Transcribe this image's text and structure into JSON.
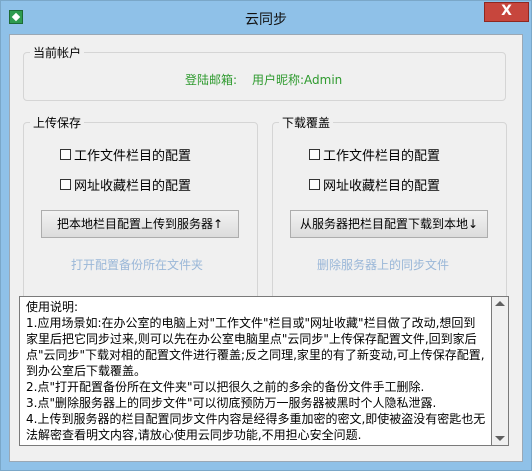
{
  "window": {
    "title": "云同步",
    "close_glyph": "X"
  },
  "account": {
    "group_title": "当前帐户",
    "email_label": "登陆邮箱:",
    "nickname_text": "用户昵称:Admin"
  },
  "upload": {
    "group_title": "上传保存",
    "checkbox_1": "工作文件栏目的配置",
    "checkbox_2": "网址收藏栏目的配置",
    "button": "把本地栏目配置上传到服务器↑",
    "link": "打开配置备份所在文件夹"
  },
  "download": {
    "group_title": "下载覆盖",
    "checkbox_1": "工作文件栏目的配置",
    "checkbox_2": "网址收藏栏目的配置",
    "button": "从服务器把栏目配置下载到本地↓",
    "link": "删除服务器上的同步文件"
  },
  "instructions": {
    "heading": "使用说明:",
    "item_1": "1.应用场景如:在办公室的电脑上对\"工作文件\"栏目或\"网址收藏\"栏目做了改动,想回到家里后把它同步过来,则可以先在办公室电脑里点\"云同步\"上传保存配置文件,回到家后点\"云同步\"下载对相的配置文件进行覆盖;反之同理,家里的有了新变动,可上传保存配置,到办公室后下载覆盖。",
    "item_2": "2.点\"打开配置备份所在文件夹\"可以把很久之前的多余的备份文件手工删除.",
    "item_3": "3.点\"删除服务器上的同步文件\"可以彻底预防万一服务器被黑时个人隐私泄露.",
    "item_4": "4.上传到服务器的栏目配置同步文件内容是经得多重加密的密文,即使被盗没有密匙也无法解密查看明文内容,请放心使用云同步功能,不用担心安全问题."
  },
  "colors": {
    "titlebar": "#8fc1e8",
    "close": "#c7463d",
    "account_text": "#2e9a2e",
    "link": "#9ab7d8"
  }
}
